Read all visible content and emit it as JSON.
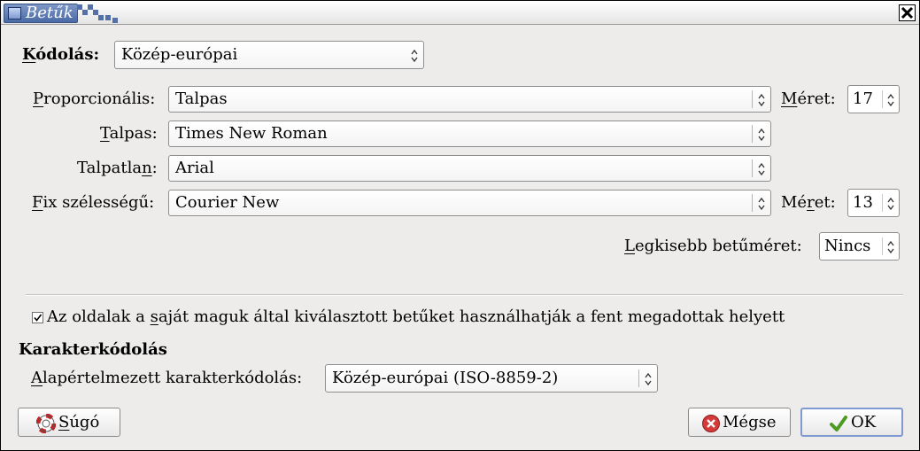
{
  "window": {
    "title": "Betűk"
  },
  "encoding": {
    "label_first": "K",
    "label_rest": "ódolás:",
    "value": "Közép-európai"
  },
  "fonts": {
    "proportional": {
      "label_first": "P",
      "label_rest": "roporcionális:",
      "value": "Talpas"
    },
    "size1": {
      "label_first": "M",
      "label_rest": "éret:",
      "value": "17"
    },
    "serif": {
      "label_first": "T",
      "label_rest": "alpas:",
      "value": "Times New Roman"
    },
    "sans": {
      "label_pre": "Talpatla",
      "label_u": "n",
      "label_post": ":",
      "value": "Arial"
    },
    "mono": {
      "label_first": "F",
      "label_rest": "ix szélességű:",
      "value": "Courier New"
    },
    "size2": {
      "label_pre": "Mé",
      "label_u": "r",
      "label_post": "et:",
      "value": "13"
    },
    "minsize": {
      "label_first": "L",
      "label_rest": "egkisebb betűméret:",
      "value": "Nincs"
    }
  },
  "allow_fonts": {
    "checked": true,
    "label_pre": "Az oldalak a ",
    "label_u": "s",
    "label_post": "aját maguk által kiválasztott betűket használhatják a fent megadottak helyett"
  },
  "charset": {
    "heading": "Karakterkódolás",
    "label_first": "A",
    "label_rest": "lapértelmezett karakterkódolás:",
    "value": "Közép-európai (ISO-8859-2)"
  },
  "buttons": {
    "help_first": "S",
    "help_rest": "úgó",
    "cancel": "Mégse",
    "ok": "OK"
  },
  "colors": {
    "accent": "#5570a8",
    "cancel_icon": "#d43a3a",
    "ok_icon": "#5aa02c"
  }
}
